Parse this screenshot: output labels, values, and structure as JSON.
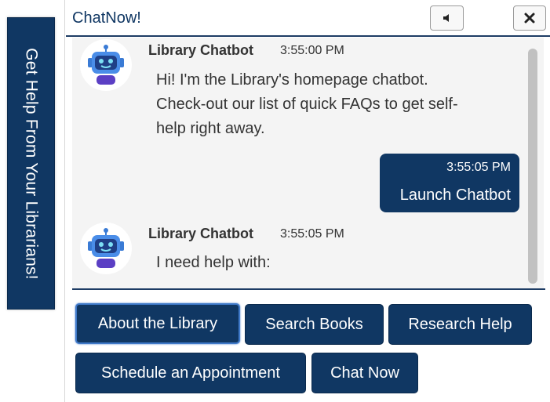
{
  "side_tab": {
    "label": "Get Help From Your Librarians!"
  },
  "header": {
    "title": "ChatNow!",
    "sound_icon": "speaker-icon",
    "close_icon": "close-icon"
  },
  "messages": [
    {
      "type": "bot",
      "avatar": "robot-icon",
      "name": "Library Chatbot",
      "time": "3:55:00 PM",
      "lines": [
        "Hi! I'm the Library's homepage chatbot.",
        "Check-out our list of quick FAQs to get self-",
        "help right away."
      ]
    },
    {
      "type": "user",
      "time": "3:55:05 PM",
      "text": "Launch Chatbot"
    },
    {
      "type": "bot",
      "avatar": "robot-icon",
      "name": "Library Chatbot",
      "time": "3:55:05 PM",
      "lines": [
        "I need help with:"
      ]
    }
  ],
  "quick_replies": [
    "About the Library",
    "Search Books",
    "Research Help",
    "Schedule an Appointment",
    "Chat Now"
  ],
  "colors": {
    "primary": "#103763",
    "accent": "#3f79c9",
    "messages_bg": "#f4f4f4"
  }
}
